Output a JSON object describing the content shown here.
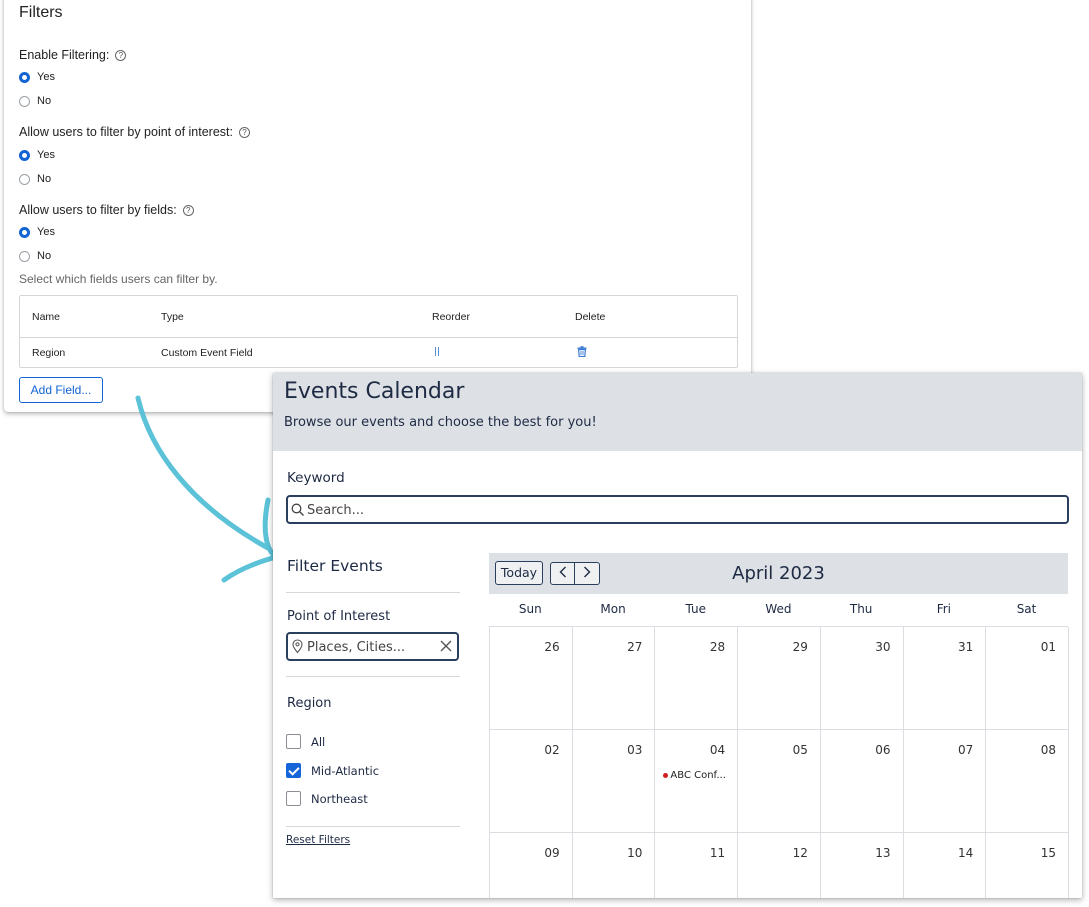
{
  "filters_panel": {
    "title": "Filters",
    "questions": [
      {
        "label": "Enable Filtering:",
        "options": [
          "Yes",
          "No"
        ],
        "selected": "Yes"
      },
      {
        "label": "Allow users to filter by point of interest:",
        "options": [
          "Yes",
          "No"
        ],
        "selected": "Yes"
      },
      {
        "label": "Allow users to filter by fields:",
        "options": [
          "Yes",
          "No"
        ],
        "selected": "Yes"
      }
    ],
    "fields_hint": "Select which fields users can filter by.",
    "table": {
      "columns": [
        "Name",
        "Type",
        "Reorder",
        "Delete"
      ],
      "rows": [
        {
          "name": "Region",
          "type": "Custom Event Field"
        }
      ]
    },
    "add_field_label": "Add Field..."
  },
  "events": {
    "title": "Events Calendar",
    "subtitle": "Browse our events and choose the best for you!",
    "keyword_label": "Keyword",
    "search_placeholder": "Search...",
    "filter_title": "Filter Events",
    "poi_label": "Point of Interest",
    "poi_placeholder": "Places, Cities...",
    "region_label": "Region",
    "region_options": [
      {
        "label": "All",
        "checked": false
      },
      {
        "label": "Mid-Atlantic",
        "checked": true
      },
      {
        "label": "Northeast",
        "checked": false
      }
    ],
    "reset_label": "Reset Filters"
  },
  "calendar": {
    "today_label": "Today",
    "prev_label": "<",
    "next_label": ">",
    "month_title": "April 2023",
    "weekdays": [
      "Sun",
      "Mon",
      "Tue",
      "Wed",
      "Thu",
      "Fri",
      "Sat"
    ],
    "weeks": [
      [
        "26",
        "27",
        "28",
        "29",
        "30",
        "31",
        "01"
      ],
      [
        "02",
        "03",
        "04",
        "05",
        "06",
        "07",
        "08"
      ],
      [
        "09",
        "10",
        "11",
        "12",
        "13",
        "14",
        "15"
      ]
    ],
    "events": [
      {
        "week": 1,
        "day": 2,
        "label": "ABC Conf..."
      }
    ]
  },
  "colors": {
    "primary_blue": "#1264d3",
    "header_gray": "#dde1e5",
    "navy_text": "#1e2a44",
    "arrow": "#5bc2d8",
    "event_dot": "#d21e1e"
  }
}
